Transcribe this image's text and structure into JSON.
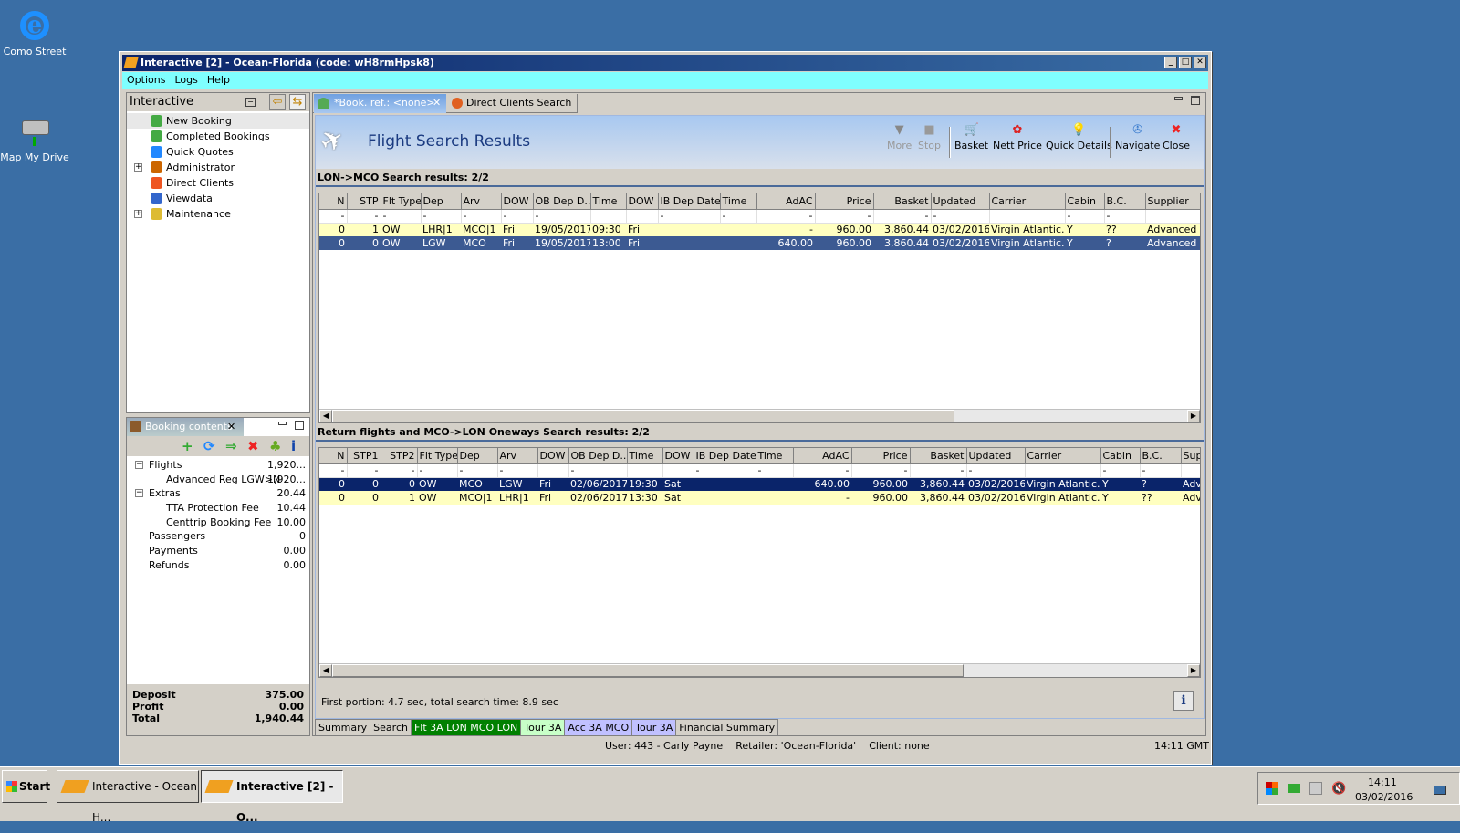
{
  "desktop": {
    "icons": [
      {
        "label": "Como Street",
        "icon": "internet-explorer-icon"
      },
      {
        "label": "Map My Drive",
        "icon": "network-drive-icon"
      }
    ]
  },
  "window": {
    "title": "Interactive [2] - Ocean-Florida (code: wH8rmHpsk8)",
    "menu": [
      "Options",
      "Logs",
      "Help"
    ]
  },
  "sidebar": {
    "title": "Interactive",
    "items": [
      {
        "label": "New Booking",
        "icon": "palm-tree-icon"
      },
      {
        "label": "Completed Bookings",
        "icon": "palm-tree-icon"
      },
      {
        "label": "Quick Quotes",
        "icon": "clock-icon"
      },
      {
        "label": "Administrator",
        "icon": "person-icon",
        "expandable": true
      },
      {
        "label": "Direct Clients",
        "icon": "clients-icon"
      },
      {
        "label": "Viewdata",
        "icon": "viewdata-icon"
      },
      {
        "label": "Maintenance",
        "icon": "maintenance-icon",
        "expandable": true
      }
    ]
  },
  "booking": {
    "title": "Booking contents",
    "tools": [
      "add-icon",
      "refresh-icon",
      "basket-transfer-icon",
      "delete-icon",
      "palm-tree-icon",
      "info-icon"
    ],
    "items": [
      {
        "label": "Flights",
        "value": "1,920...",
        "level": 0,
        "expandable": true
      },
      {
        "label": "Advanced Reg LGW>N",
        "value": "1,920...",
        "level": 1
      },
      {
        "label": "Extras",
        "value": "20.44",
        "level": 0,
        "expandable": true
      },
      {
        "label": "TTA Protection Fee",
        "value": "10.44",
        "level": 1
      },
      {
        "label": "Centtrip Booking Fee",
        "value": "10.00",
        "level": 1
      },
      {
        "label": "Passengers",
        "value": "0",
        "level": 0
      },
      {
        "label": "Payments",
        "value": "0.00",
        "level": 0
      },
      {
        "label": "Refunds",
        "value": "0.00",
        "level": 0
      }
    ],
    "totals": [
      {
        "label": "Deposit",
        "value": "375.00"
      },
      {
        "label": "Profit",
        "value": "0.00"
      },
      {
        "label": "Total",
        "value": "1,940.44"
      }
    ]
  },
  "tabs": [
    {
      "label": "*Book. ref.: <none>",
      "active": true
    },
    {
      "label": "Direct Clients Search",
      "active": false
    }
  ],
  "header": {
    "title": "Flight Search Results"
  },
  "toolbar": [
    {
      "label": "More",
      "enabled": false,
      "icon": "triangle-down-icon"
    },
    {
      "label": "Stop",
      "enabled": false,
      "icon": "stop-icon"
    },
    {
      "label": "Basket",
      "enabled": true,
      "icon": "basket-icon"
    },
    {
      "label": "Nett Price",
      "enabled": true,
      "icon": "nett-price-icon"
    },
    {
      "label": "Quick Details",
      "enabled": true,
      "icon": "lightbulb-icon"
    },
    {
      "label": "Navigate",
      "enabled": true,
      "icon": "compass-icon"
    },
    {
      "label": "Close",
      "enabled": true,
      "icon": "close-icon"
    }
  ],
  "outbound": {
    "title": "LON->MCO Search results: 2/2",
    "columns": [
      "N",
      "STP",
      "Flt Type",
      "Dep",
      "Arv",
      "DOW",
      "OB Dep D...",
      "Time",
      "DOW",
      "IB Dep Date",
      "Time",
      "AdAC",
      "Price",
      "Basket",
      "Updated",
      "Carrier",
      "Cabin",
      "B.C.",
      "Supplier"
    ],
    "filter": [
      "-",
      "-",
      "-",
      "-",
      "-",
      "-",
      "-",
      "",
      "",
      "-",
      "-",
      "-",
      "-",
      "-",
      "-",
      "",
      "-",
      "-",
      ""
    ],
    "rows": [
      {
        "state": "highlight",
        "cells": [
          "0",
          "1",
          "OW",
          "LHR|1",
          "MCO|1",
          "Fri",
          "19/05/2017",
          "09:30",
          "Fri",
          "",
          "",
          "-",
          "960.00",
          "3,860.44",
          "03/02/2016",
          "Virgin Atlantic...",
          "Y",
          "??",
          "Advanced R"
        ]
      },
      {
        "state": "selected",
        "cells": [
          "0",
          "0",
          "OW",
          "LGW",
          "MCO",
          "Fri",
          "19/05/2017",
          "13:00",
          "Fri",
          "",
          "",
          "640.00",
          "960.00",
          "3,860.44",
          "03/02/2016",
          "Virgin Atlantic...",
          "Y",
          "?",
          "Advanced R"
        ]
      }
    ]
  },
  "inbound": {
    "title": "Return flights and MCO->LON Oneways Search results: 2/2",
    "columns": [
      "N",
      "STP1",
      "STP2",
      "Flt Type",
      "Dep",
      "Arv",
      "DOW",
      "OB Dep D...",
      "Time",
      "DOW",
      "IB Dep Date",
      "Time",
      "AdAC",
      "Price",
      "Basket",
      "Updated",
      "Carrier",
      "Cabin",
      "B.C.",
      "Sup"
    ],
    "filter": [
      "-",
      "-",
      "-",
      "-",
      "-",
      "-",
      "",
      "-",
      "",
      "",
      "-",
      "-",
      "-",
      "-",
      "-",
      "-",
      "",
      "-",
      "-",
      ""
    ],
    "rows": [
      {
        "state": "selected",
        "cells": [
          "0",
          "0",
          "0",
          "OW",
          "MCO",
          "LGW",
          "Fri",
          "02/06/2017",
          "19:30",
          "Sat",
          "",
          "",
          "640.00",
          "960.00",
          "3,860.44",
          "03/02/2016",
          "Virgin Atlantic...",
          "Y",
          "?",
          "Adv"
        ]
      },
      {
        "state": "highlight",
        "cells": [
          "0",
          "0",
          "1",
          "OW",
          "MCO|1",
          "LHR|1",
          "Fri",
          "02/06/2017",
          "13:30",
          "Sat",
          "",
          "",
          "-",
          "960.00",
          "3,860.44",
          "03/02/2016",
          "Virgin Atlantic...",
          "Y",
          "??",
          "Adv"
        ]
      }
    ]
  },
  "status": {
    "timing": "First portion: 4.7 sec, total search time: 8.9 sec",
    "user": "User: 443 - Carly Payne",
    "retailer": "Retailer: 'Ocean-Florida'",
    "client": "Client: none",
    "time": "14:11 GMT"
  },
  "bottom_tabs": [
    {
      "label": "Summary",
      "color": "#d4d0c8"
    },
    {
      "label": "Search",
      "color": "#d4d0c8"
    },
    {
      "label": "Flt 3A LON MCO LON",
      "color": "#008000"
    },
    {
      "label": "Tour 3A",
      "color": "#c8ffc8"
    },
    {
      "label": "Acc 3A MCO",
      "color": "#c0c0ff"
    },
    {
      "label": "Tour 3A",
      "color": "#c0c0ff"
    },
    {
      "label": "Financial Summary",
      "color": "#d4d0c8"
    }
  ],
  "taskbar": {
    "start": "Start",
    "items": [
      "Interactive - Ocean H...",
      "Interactive [2] - O..."
    ],
    "clock_time": "14:11",
    "clock_date": "03/02/2016"
  }
}
